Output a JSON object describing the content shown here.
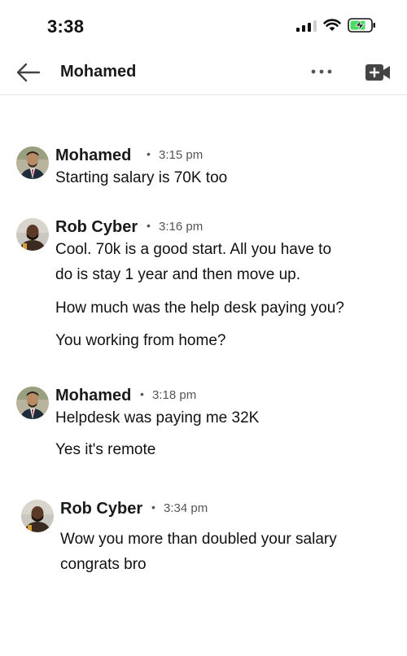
{
  "status_bar": {
    "time": "3:38"
  },
  "header": {
    "title": "Mohamed",
    "back_icon": "arrow-left-icon",
    "more_icon": "more-horizontal-icon",
    "video_icon": "video-plus-icon"
  },
  "colors": {
    "accent": "#3b3b3b",
    "battery": "#4cd964"
  },
  "messages": [
    {
      "sender": "Mohamed",
      "time": "3:15 pm",
      "lines": [
        "Starting salary is 70K too"
      ]
    },
    {
      "sender": "Rob Cyber",
      "time": "3:16 pm",
      "lines": [
        "Cool. 70k is a good start. All you have to",
        "do is stay 1 year and then move up.",
        "How much was the help desk paying you?",
        "You working from home?"
      ]
    },
    {
      "sender": "Mohamed",
      "time": "3:18 pm",
      "lines": [
        "Helpdesk was paying me 32K",
        "Yes it's remote"
      ]
    },
    {
      "sender": "Rob Cyber",
      "time": "3:34 pm",
      "lines": [
        "Wow you more than doubled your salary",
        "congrats bro"
      ]
    }
  ]
}
